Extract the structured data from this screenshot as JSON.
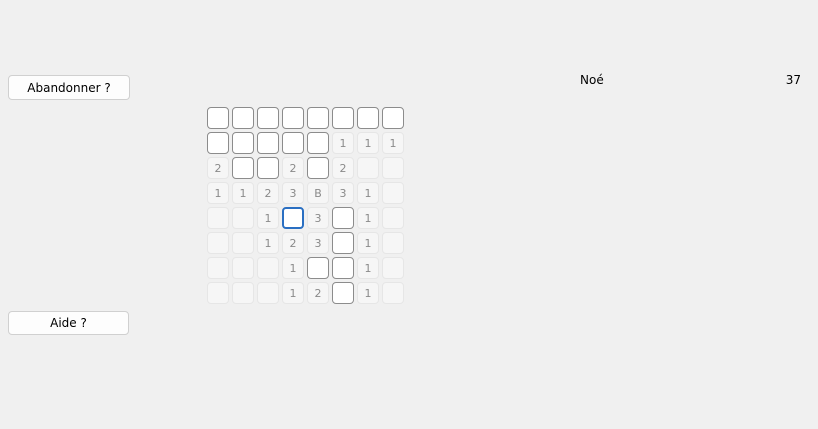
{
  "buttons": {
    "abandon_label": "Abandonner ?",
    "help_label": "Aide ?"
  },
  "player": {
    "name": "Noé",
    "score": "37"
  },
  "grid": {
    "rows": [
      [
        {
          "s": "c",
          "t": ""
        },
        {
          "s": "c",
          "t": ""
        },
        {
          "s": "c",
          "t": ""
        },
        {
          "s": "c",
          "t": ""
        },
        {
          "s": "c",
          "t": ""
        },
        {
          "s": "c",
          "t": ""
        },
        {
          "s": "c",
          "t": ""
        },
        {
          "s": "c",
          "t": ""
        }
      ],
      [
        {
          "s": "c",
          "t": ""
        },
        {
          "s": "c",
          "t": ""
        },
        {
          "s": "c",
          "t": ""
        },
        {
          "s": "c",
          "t": ""
        },
        {
          "s": "c",
          "t": ""
        },
        {
          "s": "r",
          "t": "1"
        },
        {
          "s": "r",
          "t": "1"
        },
        {
          "s": "r",
          "t": "1"
        }
      ],
      [
        {
          "s": "r",
          "t": "2"
        },
        {
          "s": "c",
          "t": ""
        },
        {
          "s": "c",
          "t": ""
        },
        {
          "s": "r",
          "t": "2"
        },
        {
          "s": "c",
          "t": ""
        },
        {
          "s": "r",
          "t": "2"
        },
        {
          "s": "r",
          "t": ""
        },
        {
          "s": "r",
          "t": ""
        }
      ],
      [
        {
          "s": "r",
          "t": "1"
        },
        {
          "s": "r",
          "t": "1"
        },
        {
          "s": "r",
          "t": "2"
        },
        {
          "s": "r",
          "t": "3"
        },
        {
          "s": "r",
          "t": "B"
        },
        {
          "s": "r",
          "t": "3"
        },
        {
          "s": "r",
          "t": "1"
        },
        {
          "s": "r",
          "t": ""
        }
      ],
      [
        {
          "s": "r",
          "t": ""
        },
        {
          "s": "r",
          "t": ""
        },
        {
          "s": "r",
          "t": "1"
        },
        {
          "s": "f",
          "t": ""
        },
        {
          "s": "r",
          "t": "3"
        },
        {
          "s": "c",
          "t": ""
        },
        {
          "s": "r",
          "t": "1"
        },
        {
          "s": "r",
          "t": ""
        }
      ],
      [
        {
          "s": "r",
          "t": ""
        },
        {
          "s": "r",
          "t": ""
        },
        {
          "s": "r",
          "t": "1"
        },
        {
          "s": "r",
          "t": "2"
        },
        {
          "s": "r",
          "t": "3"
        },
        {
          "s": "c",
          "t": ""
        },
        {
          "s": "r",
          "t": "1"
        },
        {
          "s": "r",
          "t": ""
        }
      ],
      [
        {
          "s": "r",
          "t": ""
        },
        {
          "s": "r",
          "t": ""
        },
        {
          "s": "r",
          "t": ""
        },
        {
          "s": "r",
          "t": "1"
        },
        {
          "s": "c",
          "t": ""
        },
        {
          "s": "c",
          "t": ""
        },
        {
          "s": "r",
          "t": "1"
        },
        {
          "s": "r",
          "t": ""
        }
      ],
      [
        {
          "s": "r",
          "t": ""
        },
        {
          "s": "r",
          "t": ""
        },
        {
          "s": "r",
          "t": ""
        },
        {
          "s": "r",
          "t": "1"
        },
        {
          "s": "r",
          "t": "2"
        },
        {
          "s": "c",
          "t": ""
        },
        {
          "s": "r",
          "t": "1"
        },
        {
          "s": "r",
          "t": ""
        }
      ]
    ]
  },
  "colors": {
    "background": "#f0f0f0",
    "focus_border": "#2a6fc2",
    "number_text": "#8a8a8a"
  }
}
